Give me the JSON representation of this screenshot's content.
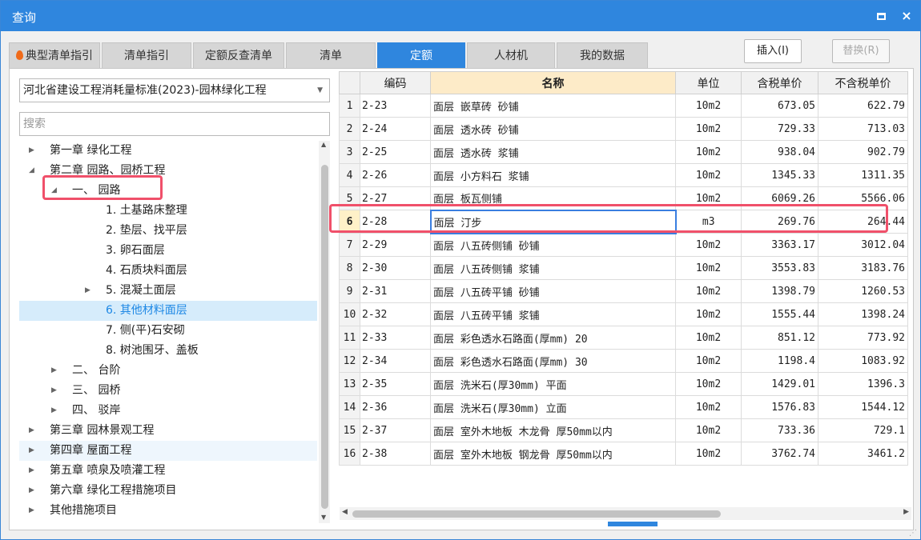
{
  "window": {
    "title": "查询",
    "close_glyph": "×"
  },
  "tabs": [
    {
      "label": "典型清单指引",
      "icon": "flame-icon"
    },
    {
      "label": "清单指引"
    },
    {
      "label": "定额反查清单"
    },
    {
      "label": "清单"
    },
    {
      "label": "定额",
      "active": true
    },
    {
      "label": "人材机"
    },
    {
      "label": "我的数据"
    }
  ],
  "buttons": {
    "insert": "插入(I)",
    "replace": "替换(R)"
  },
  "left": {
    "library": "河北省建设工程消耗量标准(2023)-园林绿化工程",
    "search_placeholder": "搜索",
    "tree": [
      {
        "label": "第一章 绿化工程",
        "caret": "right"
      },
      {
        "label": "第二章 园路、园桥工程",
        "caret": "down"
      },
      {
        "label": "一、 园路",
        "caret": "down"
      },
      {
        "label": "1. 土基路床整理"
      },
      {
        "label": "2. 垫层、找平层"
      },
      {
        "label": "3. 卵石面层"
      },
      {
        "label": "4. 石质块料面层"
      },
      {
        "label": "5. 混凝土面层",
        "caret": "right"
      },
      {
        "label": "6. 其他材料面层",
        "selected": true
      },
      {
        "label": "7. 侧(平)石安砌"
      },
      {
        "label": "8. 树池围牙、盖板"
      },
      {
        "label": "二、 台阶",
        "caret": "right"
      },
      {
        "label": "三、 园桥",
        "caret": "right"
      },
      {
        "label": "四、 驳岸",
        "caret": "right"
      },
      {
        "label": "第三章 园林景观工程",
        "caret": "right"
      },
      {
        "label": "第四章 屋面工程",
        "caret": "right",
        "hover": true
      },
      {
        "label": "第五章 喷泉及喷灌工程",
        "caret": "right"
      },
      {
        "label": "第六章 绿化工程措施项目",
        "caret": "right"
      },
      {
        "label": "其他措施项目",
        "caret": "right"
      }
    ]
  },
  "grid": {
    "headers": [
      "",
      "编码",
      "名称",
      "单位",
      "含税单价",
      "不含税单价"
    ],
    "rows": [
      [
        "1",
        "2-23",
        "面层 嵌草砖 砂铺",
        "10m2",
        "673.05",
        "622.79"
      ],
      [
        "2",
        "2-24",
        "面层 透水砖 砂铺",
        "10m2",
        "729.33",
        "713.03"
      ],
      [
        "3",
        "2-25",
        "面层 透水砖 浆铺",
        "10m2",
        "938.04",
        "902.79"
      ],
      [
        "4",
        "2-26",
        "面层 小方料石 浆铺",
        "10m2",
        "1345.33",
        "1311.35"
      ],
      [
        "5",
        "2-27",
        "面层 板瓦侧铺",
        "10m2",
        "6069.26",
        "5566.06"
      ],
      [
        "6",
        "2-28",
        "面层 汀步",
        "m3",
        "269.76",
        "264.44"
      ],
      [
        "7",
        "2-29",
        "面层 八五砖侧铺 砂铺",
        "10m2",
        "3363.17",
        "3012.04"
      ],
      [
        "8",
        "2-30",
        "面层 八五砖侧铺 浆铺",
        "10m2",
        "3553.83",
        "3183.76"
      ],
      [
        "9",
        "2-31",
        "面层 八五砖平铺 砂铺",
        "10m2",
        "1398.79",
        "1260.53"
      ],
      [
        "10",
        "2-32",
        "面层 八五砖平铺 浆铺",
        "10m2",
        "1555.44",
        "1398.24"
      ],
      [
        "11",
        "2-33",
        "面层 彩色透水石路面(厚mm) 20",
        "10m2",
        "851.12",
        "773.92"
      ],
      [
        "12",
        "2-34",
        "面层 彩色透水石路面(厚mm) 30",
        "10m2",
        "1198.4",
        "1083.92"
      ],
      [
        "13",
        "2-35",
        "面层 洗米石(厚30mm) 平面",
        "10m2",
        "1429.01",
        "1396.3"
      ],
      [
        "14",
        "2-36",
        "面层 洗米石(厚30mm) 立面",
        "10m2",
        "1576.83",
        "1544.12"
      ],
      [
        "15",
        "2-37",
        "面层 室外木地板 木龙骨 厚50mm以内",
        "10m2",
        "733.36",
        "729.1"
      ],
      [
        "16",
        "2-38",
        "面层 室外木地板 钢龙骨 厚50mm以内",
        "10m2",
        "3762.74",
        "3461.2"
      ]
    ],
    "current_row": 6
  },
  "colors": {
    "accent": "#2f86de",
    "highlight": "#f0506a",
    "selected_bg": "#d6ecfb",
    "header_name_bg": "#fdebc8"
  }
}
